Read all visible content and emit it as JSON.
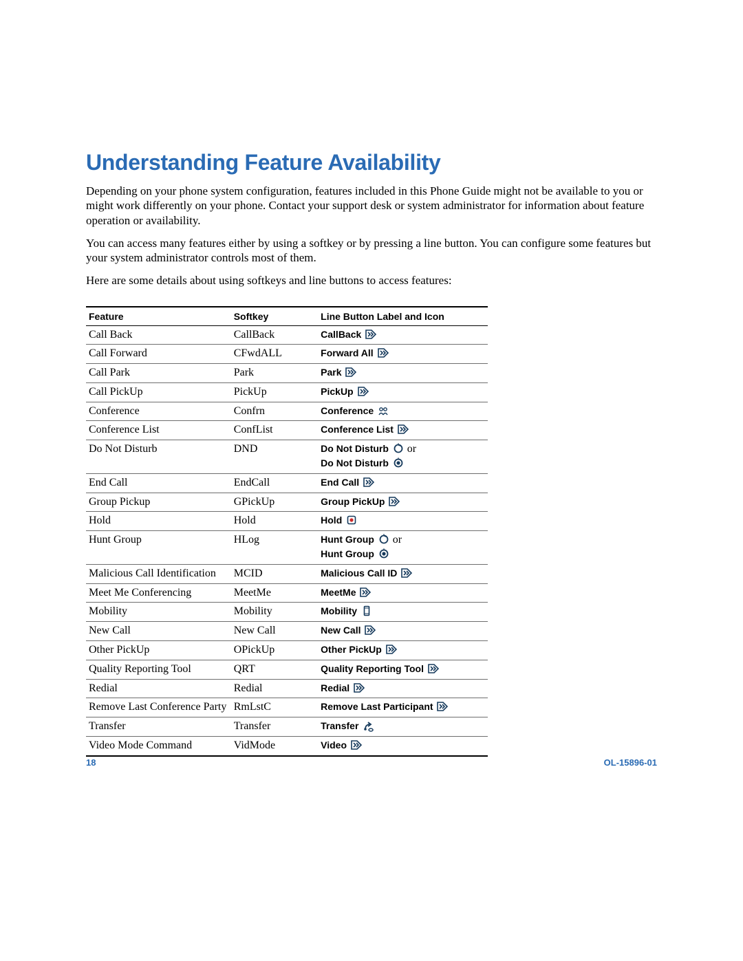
{
  "heading": "Understanding Feature Availability",
  "paragraphs": [
    "Depending on your phone system configuration, features included in this Phone Guide might not be available to you or might work differently on your phone. Contact your support desk or system administrator for information about feature operation or availability.",
    "You can access many features either by using a softkey or by pressing a line button. You can configure some features but your system administrator controls most of them.",
    "Here are some details about using softkeys and line buttons to access features:"
  ],
  "table": {
    "headers": {
      "feature": "Feature",
      "softkey": "Softkey",
      "label": "Line Button Label and Icon"
    },
    "rows": [
      {
        "feature": "Call Back",
        "softkey": "CallBack",
        "label": [
          {
            "bold": "CallBack",
            "icon": "chev"
          }
        ]
      },
      {
        "feature": "Call Forward",
        "softkey": "CFwdALL",
        "label": [
          {
            "bold": "Forward All",
            "icon": "chev"
          }
        ]
      },
      {
        "feature": "Call Park",
        "softkey": "Park",
        "label": [
          {
            "bold": "Park",
            "icon": "chev"
          }
        ]
      },
      {
        "feature": "Call PickUp",
        "softkey": "PickUp",
        "label": [
          {
            "bold": "PickUp",
            "icon": "chev"
          }
        ]
      },
      {
        "feature": "Conference",
        "softkey": "Confrn",
        "label": [
          {
            "bold": "Conference",
            "icon": "conf"
          }
        ]
      },
      {
        "feature": "Conference List",
        "softkey": "ConfList",
        "label": [
          {
            "bold": "Conference List",
            "icon": "chev"
          }
        ]
      },
      {
        "feature": "Do Not Disturb",
        "softkey": "DND",
        "label": [
          {
            "bold": "Do Not Disturb",
            "icon": "dnd-off",
            "suffix_plain": " or"
          },
          {
            "bold": "Do Not Disturb",
            "icon": "dnd-on"
          }
        ]
      },
      {
        "feature": "End Call",
        "softkey": "EndCall",
        "label": [
          {
            "bold": "End Call",
            "icon": "chev"
          }
        ]
      },
      {
        "feature": "Group Pickup",
        "softkey": "GPickUp",
        "label": [
          {
            "bold": "Group PickUp",
            "icon": "chev"
          }
        ]
      },
      {
        "feature": "Hold",
        "softkey": "Hold",
        "label": [
          {
            "bold": "Hold",
            "icon": "hold"
          }
        ]
      },
      {
        "feature": "Hunt Group",
        "softkey": "HLog",
        "label": [
          {
            "bold": "Hunt Group",
            "icon": "dnd-off",
            "suffix_plain": " or"
          },
          {
            "bold": "Hunt Group",
            "icon": "dnd-on"
          }
        ]
      },
      {
        "feature": "Malicious Call Identification",
        "softkey": "MCID",
        "label": [
          {
            "bold": "Malicious Call ID",
            "icon": "chev"
          }
        ]
      },
      {
        "feature": "Meet Me Conferencing",
        "softkey": "MeetMe",
        "label": [
          {
            "bold": "MeetMe",
            "icon": "chev"
          }
        ]
      },
      {
        "feature": "Mobility",
        "softkey": "Mobility",
        "label": [
          {
            "bold": "Mobility",
            "icon": "mobility"
          }
        ]
      },
      {
        "feature": "New Call",
        "softkey": "New Call",
        "label": [
          {
            "bold": "New Call",
            "icon": "chev"
          }
        ]
      },
      {
        "feature": "Other PickUp",
        "softkey": "OPickUp",
        "label": [
          {
            "bold": "Other PickUp",
            "icon": "chev"
          }
        ]
      },
      {
        "feature": "Quality Reporting Tool",
        "softkey": "QRT",
        "label": [
          {
            "bold": "Quality Reporting Tool",
            "icon": "chev"
          }
        ]
      },
      {
        "feature": "Redial",
        "softkey": "Redial",
        "label": [
          {
            "bold": "Redial",
            "icon": "chev"
          }
        ]
      },
      {
        "feature": "Remove Last Conference Party",
        "softkey": "RmLstC",
        "label": [
          {
            "bold": "Remove Last Participant",
            "icon": "chev"
          }
        ]
      },
      {
        "feature": "Transfer",
        "softkey": "Transfer",
        "label": [
          {
            "bold": "Transfer",
            "icon": "transfer"
          }
        ]
      },
      {
        "feature": "Video Mode Command",
        "softkey": "VidMode",
        "label": [
          {
            "bold": "Video",
            "icon": "chev"
          }
        ]
      }
    ]
  },
  "footer": {
    "page": "18",
    "docid": "OL-15896-01"
  }
}
